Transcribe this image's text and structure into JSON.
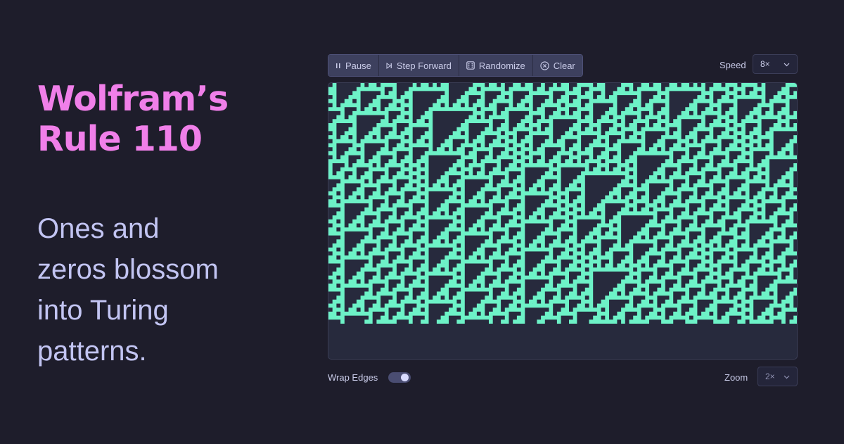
{
  "hero": {
    "title_lines": [
      "Wolfram’s",
      "Rule 110"
    ],
    "subtitle_lines": [
      "Ones and",
      "zeros blossom",
      "into Turing",
      "patterns."
    ]
  },
  "toolbar": {
    "buttons": [
      {
        "label": "Pause",
        "icon": "pause-icon"
      },
      {
        "label": "Step Forward",
        "icon": "step-forward-icon"
      },
      {
        "label": "Randomize",
        "icon": "dice-icon"
      },
      {
        "label": "Clear",
        "icon": "clear-icon"
      }
    ]
  },
  "speed": {
    "label": "Speed",
    "value": "8×"
  },
  "wrap": {
    "label": "Wrap Edges",
    "enabled": true
  },
  "zoom": {
    "label": "Zoom",
    "value": "2×"
  },
  "automaton": {
    "rule": 110,
    "generations": 60
  },
  "colors": {
    "background": "#1e1d2b",
    "title": "#f07fe9",
    "subtitle": "#c2c4f2",
    "ui_text": "#c9cbe8",
    "toolbar_bg": "#3d405e",
    "select_bg": "#24253a",
    "select_border": "#3b3d58",
    "canvas_bg": "#272a3d",
    "canvas_border": "#3a3d55",
    "cell_alive": "#6df2c7",
    "toggle_track": "#4a4d72",
    "toggle_knob": "#d9dbff"
  }
}
